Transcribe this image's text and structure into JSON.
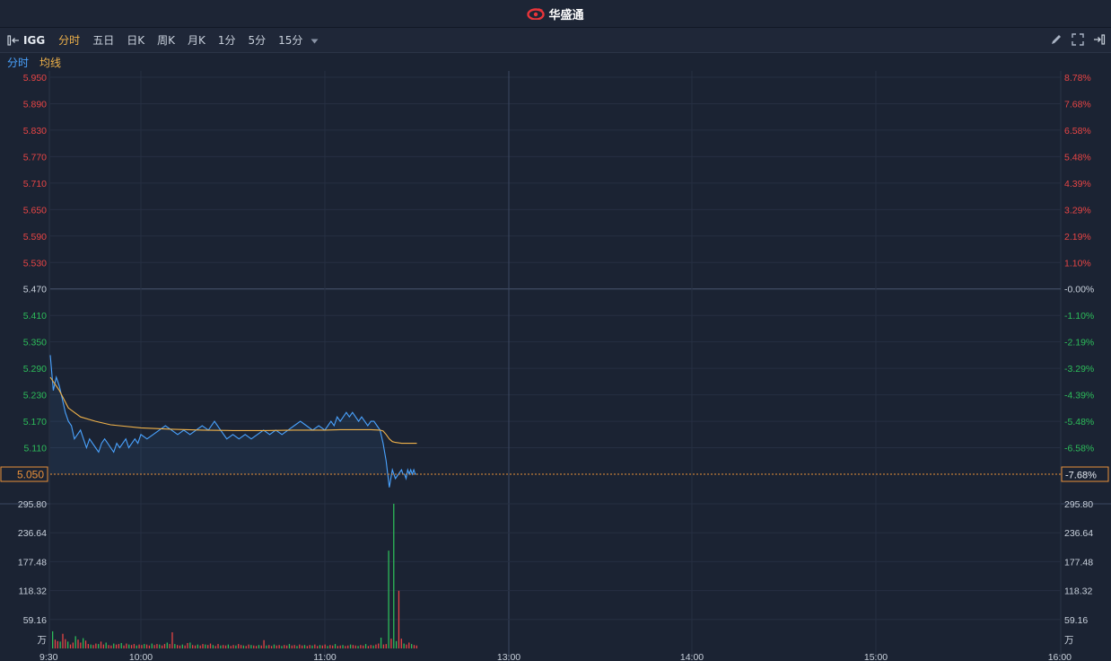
{
  "app": {
    "title": "华盛通"
  },
  "toolbar": {
    "symbol": "IGG",
    "tabs": [
      {
        "label": "分时",
        "active": true
      },
      {
        "label": "五日",
        "active": false
      },
      {
        "label": "日K",
        "active": false
      },
      {
        "label": "周K",
        "active": false
      },
      {
        "label": "月K",
        "active": false
      },
      {
        "label": "1分",
        "active": false
      },
      {
        "label": "5分",
        "active": false
      },
      {
        "label": "15分",
        "active": false
      }
    ],
    "right_icons": [
      "pencil-icon",
      "fullscreen-icon",
      "panel-right-icon"
    ]
  },
  "legend": {
    "items": [
      {
        "label": "分时",
        "color": "#4aa3ff"
      },
      {
        "label": "均线",
        "color": "#f0b24a"
      }
    ]
  },
  "colors": {
    "up": "#e84545",
    "down": "#2dbd5a",
    "price_line": "#4aa3ff",
    "avg_line": "#f0b24a",
    "current_price": "#e8903a",
    "grid": "#2b3447"
  },
  "chart_data": {
    "type": "line",
    "prev_close": 5.47,
    "current_price": {
      "label": "5.050",
      "pct": "-7.68%"
    },
    "price_ticks_left": [
      "5.950",
      "5.890",
      "5.830",
      "5.770",
      "5.710",
      "5.650",
      "5.590",
      "5.530",
      "5.470",
      "5.410",
      "5.350",
      "5.290",
      "5.230",
      "5.170",
      "5.110"
    ],
    "pct_ticks_right": [
      "8.78%",
      "7.68%",
      "6.58%",
      "5.48%",
      "4.39%",
      "3.29%",
      "2.19%",
      "1.10%",
      "-0.00%",
      "-1.10%",
      "-2.19%",
      "-3.29%",
      "-4.39%",
      "-5.48%",
      "-6.58%"
    ],
    "ylim": [
      5.05,
      5.95
    ],
    "time_ticks": [
      "9:30",
      "10:00",
      "11:00",
      "13:00",
      "14:00",
      "15:00",
      "16:00"
    ],
    "volume_ticks": [
      "295.80",
      "236.64",
      "177.48",
      "118.32",
      "59.16"
    ],
    "volume_unit": "万",
    "volume_ylim": [
      0,
      295.8
    ],
    "series": [
      {
        "name": "分时",
        "x_minutes": [
          0,
          1,
          2,
          3,
          4,
          5,
          6,
          7,
          8,
          9,
          10,
          11,
          12,
          13,
          14,
          15,
          16,
          17,
          18,
          19,
          20,
          21,
          22,
          23,
          24,
          25,
          26,
          27,
          28,
          29,
          30,
          32,
          34,
          36,
          38,
          40,
          42,
          44,
          46,
          48,
          50,
          52,
          54,
          56,
          58,
          60,
          62,
          64,
          66,
          68,
          70,
          72,
          74,
          76,
          78,
          80,
          82,
          84,
          86,
          88,
          90,
          92,
          94,
          96,
          98,
          100,
          102,
          104,
          106,
          108,
          110,
          112,
          114,
          116,
          118,
          120,
          122,
          124,
          126,
          128,
          130,
          132,
          134,
          136,
          138,
          140,
          141,
          142,
          143,
          144,
          145,
          146,
          147,
          148,
          149,
          150
        ],
        "values": [
          5.32,
          5.24,
          5.27,
          5.25,
          5.22,
          5.19,
          5.17,
          5.16,
          5.13,
          5.14,
          5.15,
          5.13,
          5.11,
          5.13,
          5.12,
          5.11,
          5.1,
          5.12,
          5.13,
          5.12,
          5.11,
          5.1,
          5.12,
          5.11,
          5.12,
          5.13,
          5.11,
          5.12,
          5.13,
          5.12,
          5.14,
          5.13,
          5.14,
          5.15,
          5.16,
          5.15,
          5.14,
          5.15,
          5.14,
          5.15,
          5.16,
          5.15,
          5.17,
          5.15,
          5.13,
          5.14,
          5.13,
          5.14,
          5.13,
          5.14,
          5.15,
          5.14,
          5.15,
          5.14,
          5.15,
          5.16,
          5.17,
          5.16,
          5.15,
          5.16,
          5.15,
          5.16,
          5.17,
          5.16,
          5.18,
          5.17,
          5.18,
          5.19,
          5.18,
          5.19,
          5.18,
          5.17,
          5.18,
          5.17,
          5.16,
          5.17,
          5.17,
          5.16,
          5.15,
          5.12,
          5.08,
          5.02,
          5.06,
          5.04,
          5.05,
          5.06,
          5.05,
          5.05,
          5.04,
          5.06,
          5.05,
          5.06,
          5.05,
          5.06,
          5.05,
          5.05
        ]
      },
      {
        "name": "均线",
        "x_minutes": [
          0,
          3,
          6,
          10,
          15,
          20,
          30,
          40,
          50,
          60,
          70,
          80,
          90,
          100,
          110,
          120,
          126,
          128,
          130,
          132,
          134,
          136,
          138,
          140,
          150
        ],
        "values": [
          5.27,
          5.24,
          5.2,
          5.18,
          5.17,
          5.162,
          5.155,
          5.152,
          5.15,
          5.149,
          5.149,
          5.15,
          5.15,
          5.151,
          5.151,
          5.151,
          5.15,
          5.148,
          5.14,
          5.13,
          5.124,
          5.122,
          5.121,
          5.12,
          5.12
        ]
      }
    ],
    "volume_values": [
      35,
      18,
      15,
      14,
      30,
      19,
      14,
      8,
      12,
      25,
      18,
      12,
      21,
      16,
      9,
      8,
      7,
      10,
      9,
      14,
      8,
      12,
      7,
      6,
      10,
      8,
      9,
      11,
      6,
      10,
      8,
      7,
      9,
      6,
      8,
      7,
      9,
      8,
      6,
      10,
      7,
      9,
      8,
      6,
      9,
      12,
      9,
      33,
      9,
      7,
      6,
      8,
      6,
      11,
      12,
      7,
      6,
      8,
      6,
      9,
      8,
      7,
      10,
      7,
      5,
      9,
      6,
      7,
      6,
      8,
      5,
      7,
      6,
      9,
      7,
      6,
      5,
      8,
      7,
      6,
      5,
      7,
      6,
      17,
      6,
      7,
      5,
      8,
      6,
      7,
      5,
      7,
      6,
      9,
      6,
      7,
      5,
      8,
      6,
      7,
      5,
      7,
      6,
      8,
      5,
      7,
      6,
      8,
      5,
      7,
      6,
      9,
      5,
      6,
      7,
      5,
      6,
      8,
      7,
      6,
      5,
      7,
      6,
      9,
      5,
      7,
      6,
      8,
      10,
      22,
      8,
      9,
      200,
      20,
      296,
      15,
      118,
      20,
      10,
      8,
      12,
      9,
      7,
      6
    ]
  }
}
